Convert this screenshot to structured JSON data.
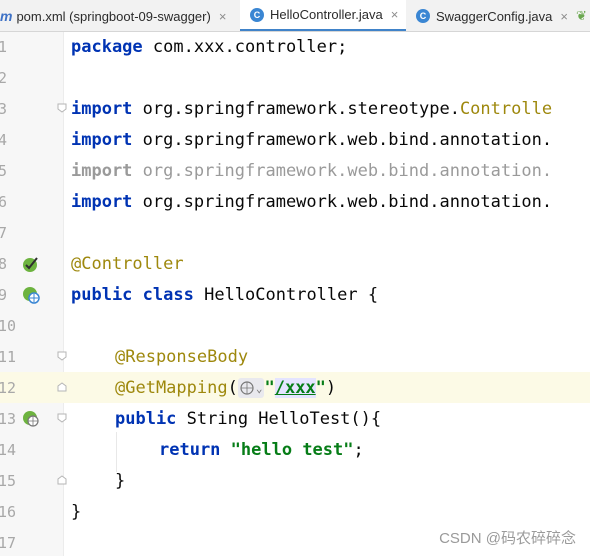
{
  "tabs": [
    {
      "label": "pom.xml (springboot-09-swagger)",
      "icon": "maven-icon",
      "close": "×"
    },
    {
      "label": "HelloController.java",
      "icon": "class-icon",
      "close": "×"
    },
    {
      "label": "SwaggerConfig.java",
      "icon": "class-icon",
      "close": "×"
    }
  ],
  "line_numbers": [
    "1",
    "2",
    "3",
    "4",
    "5",
    "6",
    "7",
    "8",
    "9",
    "10",
    "11",
    "12",
    "13",
    "14",
    "15",
    "16",
    "17"
  ],
  "code": {
    "l1_kw": "package",
    "l1_rest": " com.xxx.controller;",
    "l3_kw": "import",
    "l3_rest": " org.springframework.stereotype.",
    "l3_cls": "Controlle",
    "l4_kw": "import",
    "l4_rest": " org.springframework.web.bind.annotation.",
    "l5_kw": "import",
    "l5_rest": " org.springframework.web.bind.annotation.",
    "l6_kw": "import",
    "l6_rest": " org.springframework.web.bind.annotation.",
    "l8": "@Controller",
    "l9_kw1": "public",
    "l9_kw2": "class",
    "l9_rest": " HelloController {",
    "l11": "@ResponseBody",
    "l12_anno": "@GetMapping",
    "l12_open": "(",
    "l12_q1": "\"",
    "l12_path": "/xxx",
    "l12_q2": "\"",
    "l12_close": ")",
    "l13_kw": "public",
    "l13_rest": " String HelloTest(){",
    "l14_kw": "return",
    "l14_str": "\"hello test\"",
    "l14_semi": ";",
    "l15": "}",
    "l16": "}"
  },
  "watermark": "CSDN @码农碎碎念",
  "colors": {
    "keyword": "#0033b3",
    "annotation": "#9e880d",
    "string": "#067d17",
    "active_tab_underline": "#4083c9"
  }
}
